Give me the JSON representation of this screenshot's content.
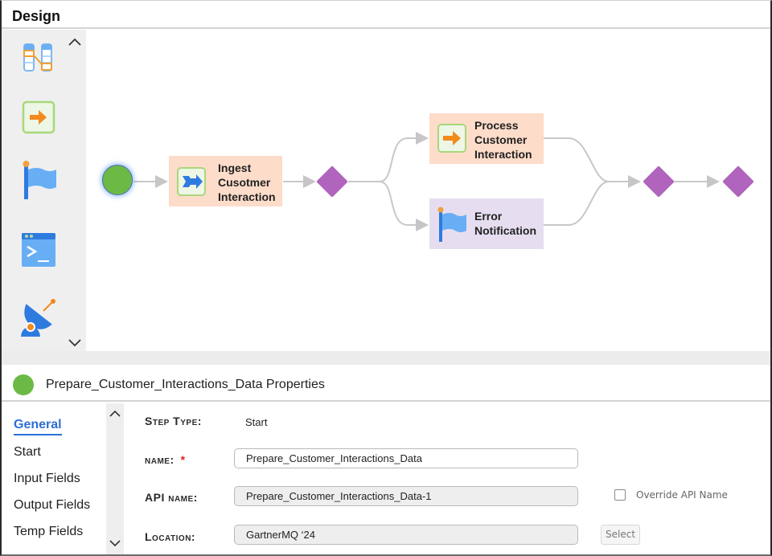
{
  "header": {
    "title": "Design"
  },
  "palette": {
    "tools": [
      {
        "name": "mapping-tool",
        "icon": "data-mapping-icon"
      },
      {
        "name": "assignment-tool",
        "icon": "arrow-right-box-icon"
      },
      {
        "name": "notification-tool",
        "icon": "flag-icon"
      },
      {
        "name": "command-tool",
        "icon": "terminal-icon"
      },
      {
        "name": "receive-tool",
        "icon": "satellite-dish-icon"
      }
    ],
    "scroll_up": "scroll-up",
    "scroll_down": "scroll-down"
  },
  "canvas": {
    "nodes": {
      "ingest": {
        "label_lines": [
          "Ingest",
          "Cusotmer",
          "Interaction"
        ],
        "color": "#fddcca",
        "icon": "data-transfer-icon"
      },
      "process": {
        "label_lines": [
          "Process",
          "Customer",
          "Interaction"
        ],
        "color": "#fddcca",
        "icon": "arrow-right-box-icon"
      },
      "error": {
        "label_lines": [
          "Error",
          "Notification"
        ],
        "color": "#e6def0",
        "icon": "flag-icon"
      }
    },
    "colors": {
      "start": "#6cba45",
      "gateway": "#b064bd",
      "connector": "#c6c6c6"
    }
  },
  "properties": {
    "title": "Prepare_Customer_Interactions_Data Properties",
    "nav": [
      "General",
      "Start",
      "Input Fields",
      "Output Fields",
      "Temp Fields"
    ],
    "active_nav": "General",
    "form": {
      "step_type_label": "Step Type:",
      "step_type_value": "Start",
      "name_label": "name:",
      "name_required": "*",
      "name_value": "Prepare_Customer_Interactions_Data",
      "api_name_label": "API name:",
      "api_name_value": "Prepare_Customer_Interactions_Data-1",
      "override_label": "Override API Name",
      "override_checked": false,
      "location_label": "Location:",
      "location_value": "GartnerMQ ‘24",
      "select_label": "Select"
    }
  }
}
